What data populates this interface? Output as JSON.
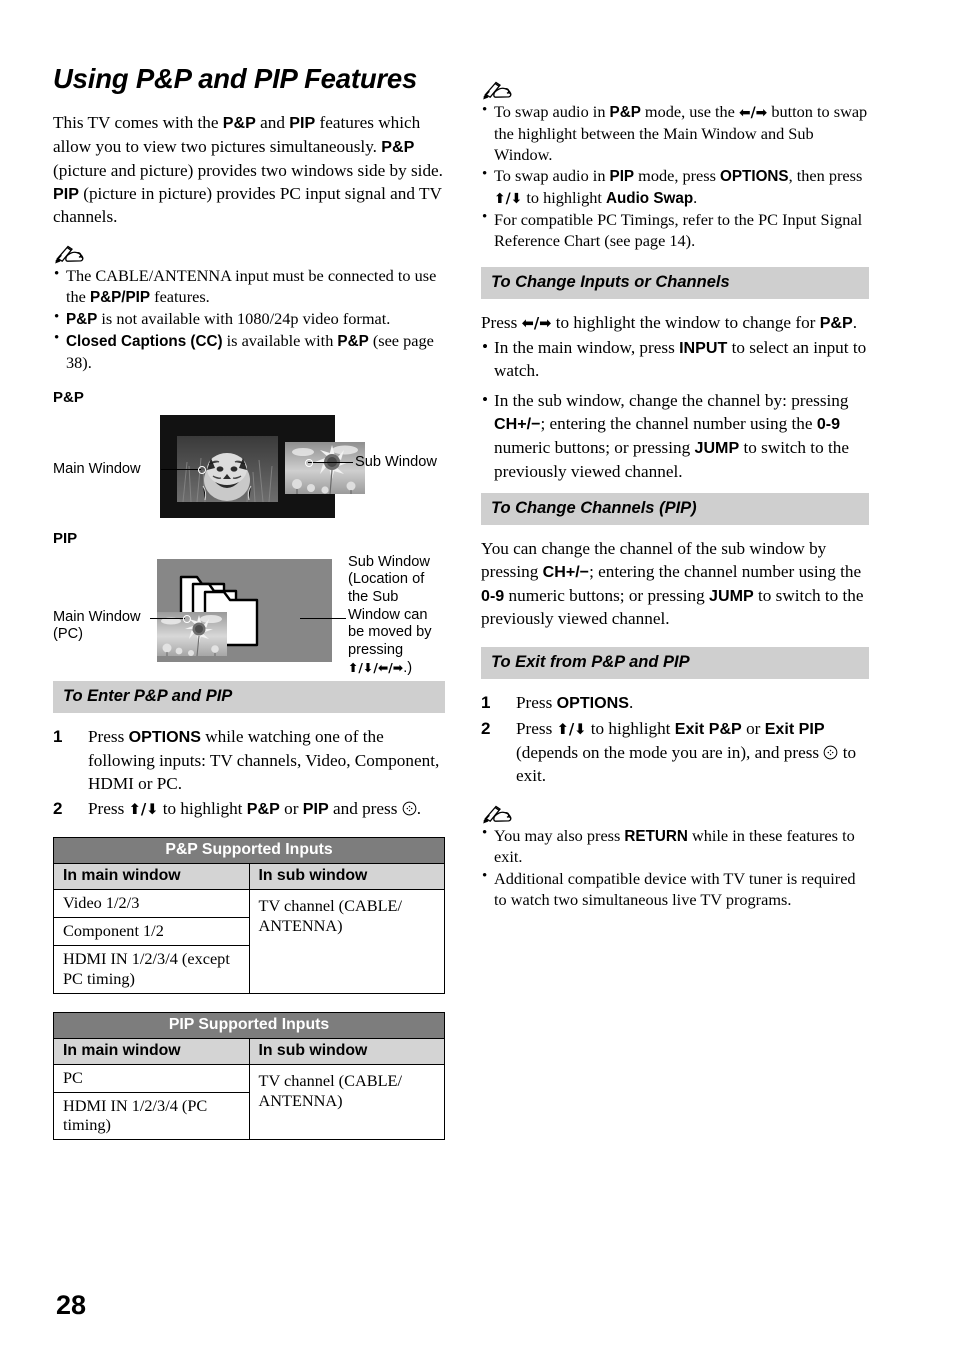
{
  "page": {
    "number": "28",
    "title": "Using P&P and PIP Features"
  },
  "intro": {
    "text_html": "This TV comes with the <b>P&amp;P</b> and <b>PIP</b> features which allow you to view two pictures simultaneously. <b>P&amp;P</b> (picture and picture) provides two windows side by side. <b>PIP</b> (picture in picture) provides PC input signal and TV channels."
  },
  "note_left": {
    "icon": "memo-pen-icon",
    "items_html": [
      "The CABLE/ANTENNA input must be connected to use the <b>P&amp;P/PIP</b> features.",
      "<b>P&amp;P</b> is not available with 1080/24p video format.",
      "<b>Closed Captions (CC)</b> is available with <b>P&amp;P</b> (see page 38)."
    ]
  },
  "figures": {
    "pp": {
      "label": "P&P",
      "main_callout": "Main Window",
      "sub_callout": "Sub Window"
    },
    "pip": {
      "label": "PIP",
      "main_callout_line1": "Main Window",
      "main_callout_line2": "(PC)",
      "sub_callout": "Sub Window (Location of the Sub Window can be moved by pressing ♦/♦/♦/♦.)",
      "sub_callout_html": "Sub Window<br>(Location of<br>the Sub<br>Window can<br>be moved by<br>pressing<br><span class=\"arrow\">⬆/⬇/⬅/➡</span>.)"
    }
  },
  "section_enter": {
    "heading": "To Enter P&P and PIP",
    "steps": [
      {
        "num": "1",
        "text_html": "Press <b>OPTIONS</b> while watching one of the following inputs: TV channels, Video, Component, HDMI or PC."
      },
      {
        "num": "2",
        "text_html": "Press <span class=\"arrow\">⬆/⬇</span> to highlight <b>P&amp;P</b> or <b>PIP</b> and press <span class=\"enterkey\"></span>."
      }
    ]
  },
  "table_pp": {
    "title": "P&P Supported Inputs",
    "columns": [
      "In main window",
      "In sub window"
    ],
    "main_rows": [
      "Video 1/2/3",
      "Component 1/2",
      "HDMI IN 1/2/3/4 (except PC timing)"
    ],
    "sub_value": "TV channel (CABLE/ ANTENNA)"
  },
  "table_pip": {
    "title": "PIP Supported Inputs",
    "columns": [
      "In main window",
      "In sub window"
    ],
    "main_rows": [
      "PC",
      "HDMI IN 1/2/3/4 (PC timing)"
    ],
    "sub_value": "TV channel (CABLE/ ANTENNA)"
  },
  "note_right": {
    "icon": "memo-pen-icon",
    "items_html": [
      "To swap audio in <b>P&amp;P</b> mode, use the <span class=\"arrow\">⬅/➡</span> button to swap the highlight between the Main Window and Sub Window.",
      "To swap audio in <b>PIP</b> mode, press <b>OPTIONS</b>, then press <span class=\"arrow\">⬆/⬇</span> to highlight <b>Audio Swap</b>.",
      "For compatible PC Timings, refer to the PC Input Signal Reference Chart (see page 14)."
    ]
  },
  "section_change_inputs": {
    "heading": "To Change Inputs or Channels",
    "intro_html": "Press <span class=\"arrow\">⬅/➡</span> to highlight the window to change for <b>P&amp;P</b>.",
    "bullets_html": [
      "In the main window, press <b>INPUT</b> to select an input to watch.",
      "In the sub window, change the channel by: pressing <b>CH+/−</b>; entering the channel number using the <b>0-9</b> numeric buttons; or pressing <b>JUMP</b> to switch to the previously viewed channel."
    ]
  },
  "section_change_channels": {
    "heading": "To Change Channels (PIP)",
    "text_html": "You can change the channel of the sub window by pressing <b>CH+/−</b>; entering the channel number using the <b>0-9</b> numeric buttons; or pressing <b>JUMP</b> to switch to the previously viewed channel."
  },
  "section_exit": {
    "heading": "To Exit from P&P and PIP",
    "steps": [
      {
        "num": "1",
        "text_html": "Press <b>OPTIONS</b>."
      },
      {
        "num": "2",
        "text_html": "Press <span class=\"arrow\">⬆/⬇</span> to highlight <b>Exit P&amp;P</b> or <b>Exit PIP</b> (depends on the mode you are in), and press <span class=\"enterkey\"></span> to exit."
      }
    ]
  },
  "note_exit": {
    "icon": "memo-pen-icon",
    "items_html": [
      "You may also press <b>RETURN</b> while in these features to exit.",
      "Additional compatible device with TV tuner is required to watch two simultaneous live TV programs."
    ]
  },
  "colors": {
    "section_bar": "#cfcfcf",
    "table_title_bar": "#7d7d7d",
    "table_colhead": "#d4d4d4",
    "pp_screen_bg": "#121212",
    "pip_screen_bg": "#878787"
  }
}
